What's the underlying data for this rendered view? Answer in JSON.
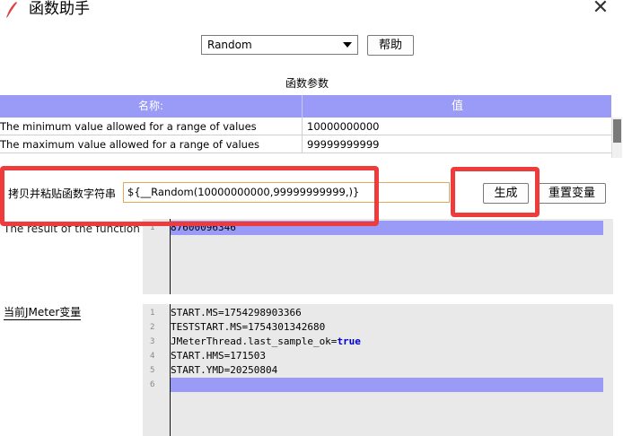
{
  "window": {
    "title": "函数助手",
    "icon": "feather-pen-icon",
    "close_glyph": "✕"
  },
  "function_select": {
    "selected": "Random"
  },
  "buttons": {
    "help": "帮助",
    "generate": "生成",
    "reset": "重置变量"
  },
  "params": {
    "title": "函数参数",
    "columns": [
      "名称:",
      "值"
    ],
    "rows": [
      {
        "name": "The minimum value allowed for a range of values",
        "value": "10000000000"
      },
      {
        "name": "The maximum value allowed for a range of values",
        "value": "99999999999"
      }
    ]
  },
  "function_string": {
    "label": "拷贝并粘贴函数字符串",
    "value": "${__Random(10000000000,99999999999,)}"
  },
  "result": {
    "label": "The result of the function is",
    "lines": [
      {
        "n": "1",
        "text": "87600096346"
      }
    ]
  },
  "jmeter_vars": {
    "label": "当前JMeter变量",
    "lines": [
      {
        "n": "1",
        "text": "START.MS=1754298903366"
      },
      {
        "n": "2",
        "text": "TESTSTART.MS=1754301342680"
      },
      {
        "n": "3",
        "key": "JMeterThread.last_sample_ok=",
        "kw": "true"
      },
      {
        "n": "4",
        "text": "START.HMS=171503"
      },
      {
        "n": "5",
        "text": "START.YMD=20250804"
      },
      {
        "n": "6",
        "text": ""
      }
    ]
  },
  "colors": {
    "header_purple": "#9a9af7",
    "highlight_red": "#ee3b3b",
    "input_border": "#e3a857"
  }
}
